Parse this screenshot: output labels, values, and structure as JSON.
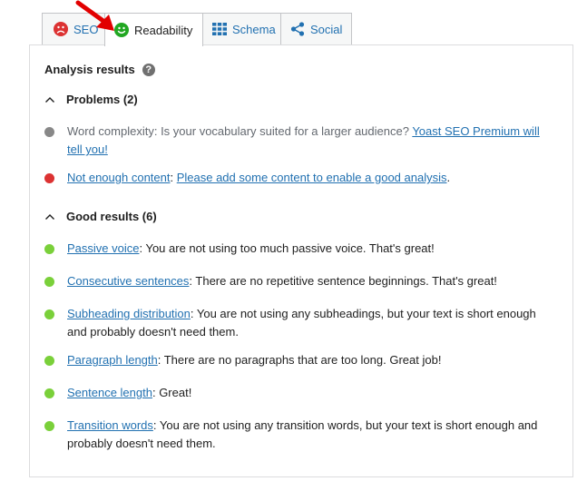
{
  "tabs": [
    {
      "label": "SEO",
      "icon": "frown-face-icon"
    },
    {
      "label": "Readability",
      "icon": "smile-face-icon"
    },
    {
      "label": "Schema",
      "icon": "grid-icon"
    },
    {
      "label": "Social",
      "icon": "share-icon"
    }
  ],
  "panel": {
    "title": "Analysis results",
    "problems": {
      "heading": "Problems (2)",
      "items": [
        {
          "status": "grey",
          "text": "Word complexity: Is your vocabulary suited for a larger audience? ",
          "link": "Yoast SEO Premium will tell you!"
        },
        {
          "status": "red",
          "link": "Not enough content",
          "sep": ": ",
          "link2": "Please add some content to enable a good analysis",
          "tail": "."
        }
      ]
    },
    "good": {
      "heading": "Good results (6)",
      "items": [
        {
          "link": "Passive voice",
          "text": ": You are not using too much passive voice. That's great!"
        },
        {
          "link": "Consecutive sentences",
          "text": ": There are no repetitive sentence beginnings. That's great!"
        },
        {
          "link": "Subheading distribution",
          "text": ": You are not using any subheadings, but your text is short enough and probably doesn't need them."
        },
        {
          "link": "Paragraph length",
          "text": ": There are no paragraphs that are too long. Great job!"
        },
        {
          "link": "Sentence length",
          "text": ": Great!"
        },
        {
          "link": "Transition words",
          "text": ": You are not using any transition words, but your text is short enough and probably doesn't need them."
        }
      ]
    }
  },
  "colors": {
    "red": "#dc3232",
    "green": "#7ad03a",
    "grey": "#888888",
    "link": "#2271b1",
    "arrow": "#e20000"
  }
}
